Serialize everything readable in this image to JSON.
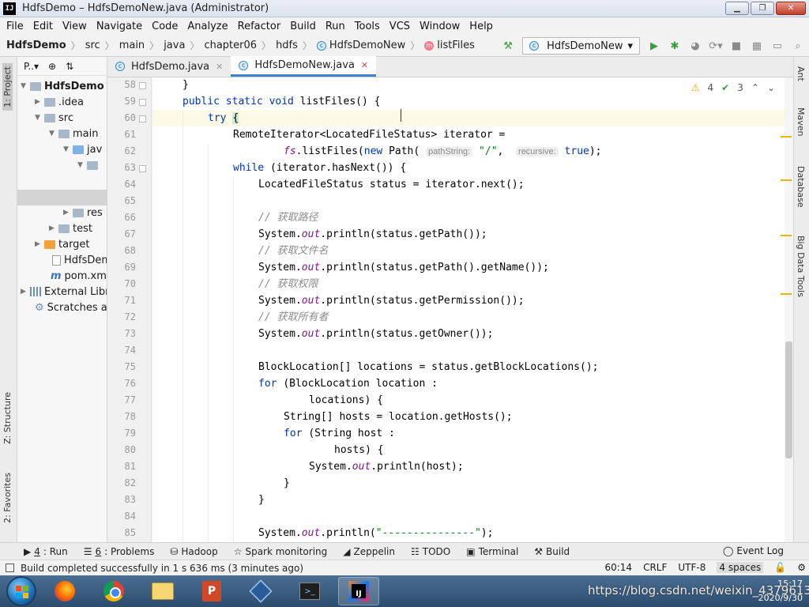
{
  "window": {
    "title": "HdfsDemo – HdfsDemoNew.java (Administrator)",
    "app_icon_text": "IJ"
  },
  "menu": [
    "File",
    "Edit",
    "View",
    "Navigate",
    "Code",
    "Analyze",
    "Refactor",
    "Build",
    "Run",
    "Tools",
    "VCS",
    "Window",
    "Help"
  ],
  "breadcrumb": [
    "HdfsDemo",
    "src",
    "main",
    "java",
    "chapter06",
    "hdfs",
    "HdfsDemoNew",
    "listFiles"
  ],
  "run_config": "HdfsDemoNew",
  "left_tabs": {
    "project": "1: Project",
    "structure": "Z: Structure",
    "favorites": "2: Favorites"
  },
  "right_tabs": [
    "Ant",
    "Maven",
    "Database",
    "Big Data Tools"
  ],
  "project_panel": {
    "header": "P..▾",
    "rows": [
      {
        "label": "HdfsDemo",
        "bold": true
      },
      {
        "label": ".idea"
      },
      {
        "label": "src"
      },
      {
        "label": "main"
      },
      {
        "label": "jav"
      },
      {
        "label": ""
      },
      {
        "label": "res"
      },
      {
        "label": "test"
      },
      {
        "label": "target"
      },
      {
        "label": "HdfsDem"
      },
      {
        "label": "pom.xml"
      },
      {
        "label": "External Libr"
      },
      {
        "label": "Scratches ar"
      }
    ]
  },
  "tabs": [
    {
      "label": "HdfsDemo.java",
      "active": false
    },
    {
      "label": "HdfsDemoNew.java",
      "active": true
    }
  ],
  "inspections": {
    "warnings": "4",
    "weak_warnings": "3"
  },
  "line_numbers": [
    "58",
    "59",
    "60",
    "61",
    "62",
    "63",
    "64",
    "65",
    "66",
    "67",
    "68",
    "69",
    "70",
    "71",
    "72",
    "73",
    "74",
    "75",
    "76",
    "77",
    "78",
    "79",
    "80",
    "81",
    "82",
    "83",
    "84",
    "85"
  ],
  "code": {
    "l58": "}",
    "l59_a": "public static void ",
    "l59_b": "listFiles() {",
    "l60_kw": "try ",
    "l60_brace": "{",
    "l61": "RemoteIterator<LocatedFileStatus> iterator =",
    "l62_fs": "fs",
    "l62_a": ".listFiles(",
    "l62_new": "new ",
    "l62_b": "Path( ",
    "l62_hint1": "pathString:",
    "l62_str": " \"/\"",
    "l62_c": ",  ",
    "l62_hint2": "recursive:",
    "l62_true": " true",
    "l62_d": ");",
    "l63_kw": "while ",
    "l63_rest": "(iterator.hasNext()) {",
    "l64": "LocatedFileStatus status = iterator.next();",
    "l66": "// 获取路径",
    "l67_a": "System.",
    "l67_out": "out",
    "l67_b": ".println(status.getPath());",
    "l68": "// 获取文件名",
    "l69_a": "System.",
    "l69_out": "out",
    "l69_b": ".println(status.getPath().getName());",
    "l70": "// 获取权限",
    "l71_a": "System.",
    "l71_out": "out",
    "l71_b": ".println(status.getPermission());",
    "l72": "// 获取所有者",
    "l73_a": "System.",
    "l73_out": "out",
    "l73_b": ".println(status.getOwner());",
    "l75": "BlockLocation[] locations = status.getBlockLocations();",
    "l76_kw": "for ",
    "l76_rest": "(BlockLocation location :",
    "l77": "locations) {",
    "l78": "String[] hosts = location.getHosts();",
    "l79_kw": "for ",
    "l79_rest": "(String host :",
    "l80": "hosts) {",
    "l81_a": "System.",
    "l81_out": "out",
    "l81_b": ".println(host);",
    "l82": "}",
    "l83": "}",
    "l85_a": "System.",
    "l85_out": "out",
    "l85_b": ".println(",
    "l85_str": "\"---------------\"",
    "l85_c": ");"
  },
  "tool_windows": [
    {
      "num": "4",
      "label": ": Run"
    },
    {
      "num": "6",
      "label": ": Problems"
    },
    {
      "num": "",
      "label": "Hadoop"
    },
    {
      "num": "",
      "label": "Spark monitoring"
    },
    {
      "num": "",
      "label": "Zeppelin"
    },
    {
      "num": "",
      "label": "TODO"
    },
    {
      "num": "",
      "label": "Terminal"
    },
    {
      "num": "",
      "label": "Build"
    }
  ],
  "event_log": "Event Log",
  "status": {
    "message": "Build completed successfully in 1 s 636 ms (3 minutes ago)",
    "position": "60:14",
    "line_sep": "CRLF",
    "encoding": "UTF-8",
    "indent": "4 spaces"
  },
  "tray": {
    "time": "15:17",
    "date": "2020/9/30"
  },
  "watermark": "https://blog.csdn.net/weixin_43796131"
}
